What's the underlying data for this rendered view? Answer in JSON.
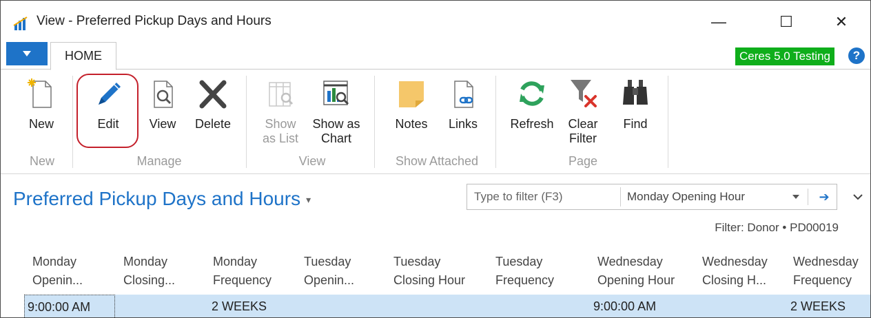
{
  "window": {
    "title": "View - Preferred Pickup Days and Hours",
    "minimize": "—",
    "maximize": "☐",
    "close": "✕"
  },
  "tabs": {
    "home": "HOME",
    "environment": "Ceres 5.0 Testing",
    "help": "?"
  },
  "ribbon": {
    "new": "New",
    "edit": "Edit",
    "view": "View",
    "delete": "Delete",
    "show_as_list_1": "Show",
    "show_as_list_2": "as List",
    "show_as_chart_1": "Show as",
    "show_as_chart_2": "Chart",
    "notes": "Notes",
    "links": "Links",
    "refresh": "Refresh",
    "clear_filter_1": "Clear",
    "clear_filter_2": "Filter",
    "find": "Find",
    "groups": {
      "new": "New",
      "manage": "Manage",
      "view": "View",
      "show_attached": "Show Attached",
      "page": "Page"
    }
  },
  "page": {
    "title": "Preferred Pickup Days and Hours",
    "filter_placeholder": "Type to filter (F3)",
    "filter_field": "Monday Opening Hour",
    "filter_info": "Filter: Donor • PD00019"
  },
  "grid": {
    "columns": [
      [
        "Monday",
        "Openin..."
      ],
      [
        "Monday",
        "Closing..."
      ],
      [
        "Monday",
        "Frequency"
      ],
      [
        "Tuesday",
        "Openin..."
      ],
      [
        "Tuesday",
        "Closing Hour"
      ],
      [
        "Tuesday",
        "Frequency"
      ],
      [
        "Wednesday",
        "Opening Hour"
      ],
      [
        "Wednesday",
        "Closing H..."
      ],
      [
        "Wednesday",
        "Frequency"
      ]
    ],
    "row": {
      "monday_opening": "9:00:00 AM",
      "monday_frequency": "2 WEEKS",
      "wednesday_opening": "9:00:00 AM",
      "wednesday_frequency": "2 WEEKS"
    }
  },
  "colors": {
    "accent": "#1e73c8",
    "environment_badge": "#0fae1b",
    "edit_highlight": "#c4202b",
    "selected_row": "#cde3f6"
  }
}
